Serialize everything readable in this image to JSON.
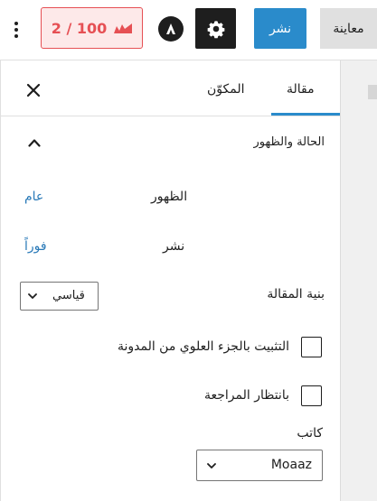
{
  "toolbar": {
    "more_icon": "kebab-vertical-icon",
    "seo_score": "2 / 100",
    "seo_icon": "seo-score-icon",
    "astra_icon": "astra-logo-icon",
    "settings_icon": "gear-icon",
    "publish_label": "نشر",
    "preview_label": "معاينة"
  },
  "sidebar": {
    "tabs": {
      "post": "مقالة",
      "block": "المكوّن",
      "active": "post"
    },
    "close_icon": "close-icon",
    "panel": {
      "title": "الحالة والظهور",
      "expanded": true,
      "visibility_label": "الظهور",
      "visibility_value": "عام",
      "publish_label": "نشر",
      "publish_value": "فوراً",
      "format_label": "بنية المقالة",
      "format_value": "قياسي",
      "sticky_label": "التثبيت بالجزء العلوي من المدونة",
      "sticky_checked": false,
      "pending_label": "بانتظار المراجعة",
      "pending_checked": false,
      "author_label": "كاتب",
      "author_value": "Moaaz"
    }
  },
  "colors": {
    "accent": "#2a8bcb",
    "link": "#2a7ab8",
    "seo_bad": "#e65054",
    "seo_bad_bg": "#fde9e9",
    "dark": "#1e1e1e"
  }
}
